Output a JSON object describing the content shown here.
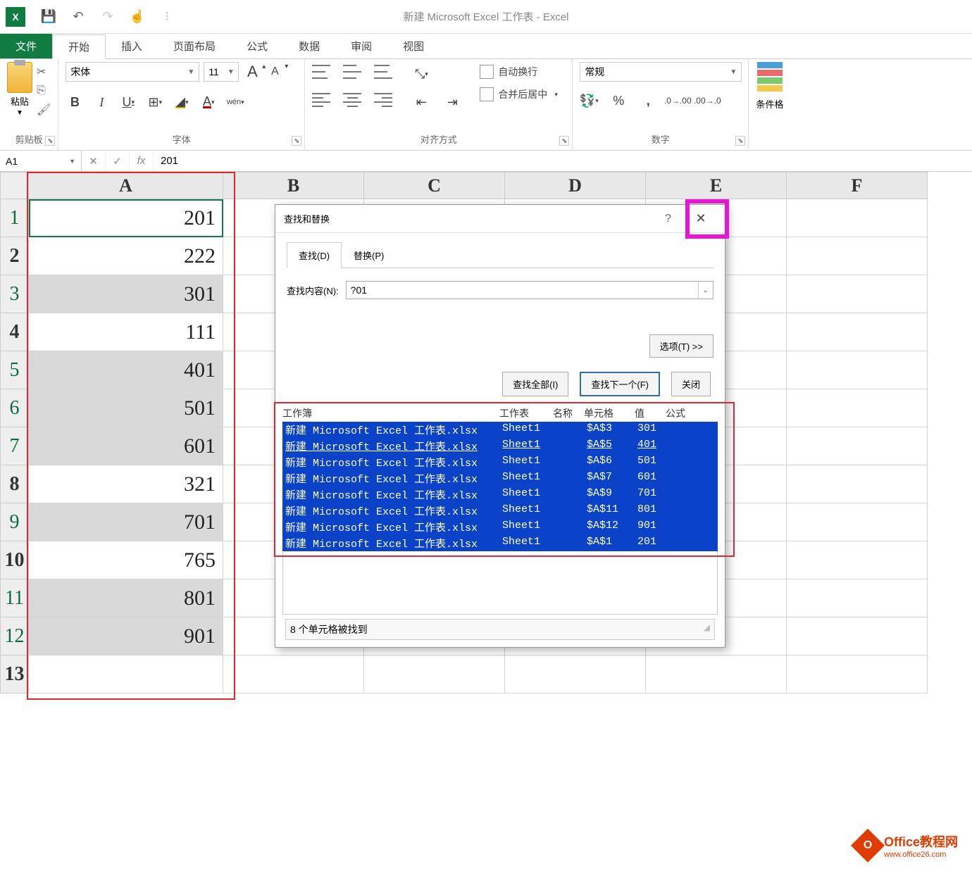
{
  "app": {
    "doc_title": "新建 Microsoft Excel 工作表 - Excel"
  },
  "qat": {
    "save": "save",
    "undo": "undo",
    "redo": "redo",
    "touch": "touch"
  },
  "tabs": {
    "file": "文件",
    "home": "开始",
    "insert": "插入",
    "page_layout": "页面布局",
    "formulas": "公式",
    "data": "数据",
    "review": "审阅",
    "view": "视图"
  },
  "ribbon": {
    "clipboard": {
      "paste": "粘贴",
      "label": "剪贴板"
    },
    "font": {
      "name": "宋体",
      "size": "11",
      "bold": "B",
      "italic": "I",
      "underline": "U",
      "label": "字体",
      "phonetic": "wén"
    },
    "alignment": {
      "wrap": "自动换行",
      "merge": "合并后居中",
      "label": "对齐方式"
    },
    "number": {
      "format": "常规",
      "label": "数字"
    },
    "styles": {
      "cf": "条件格"
    }
  },
  "formula_bar": {
    "name_box": "A1",
    "fx": "fx",
    "value": "201",
    "cancel": "✕",
    "enter": "✓"
  },
  "sheet": {
    "cols": [
      "A",
      "B",
      "C",
      "D",
      "E",
      "F"
    ],
    "rows": [
      {
        "n": "1",
        "v": "201",
        "sel": true,
        "active": true
      },
      {
        "n": "2",
        "v": "222",
        "sel": false
      },
      {
        "n": "3",
        "v": "301",
        "sel": true
      },
      {
        "n": "4",
        "v": "111",
        "sel": false
      },
      {
        "n": "5",
        "v": "401",
        "sel": true
      },
      {
        "n": "6",
        "v": "501",
        "sel": true
      },
      {
        "n": "7",
        "v": "601",
        "sel": true
      },
      {
        "n": "8",
        "v": "321",
        "sel": false
      },
      {
        "n": "9",
        "v": "701",
        "sel": true
      },
      {
        "n": "10",
        "v": "765",
        "sel": false
      },
      {
        "n": "11",
        "v": "801",
        "sel": true
      },
      {
        "n": "12",
        "v": "901",
        "sel": true
      },
      {
        "n": "13",
        "v": "",
        "sel": false
      }
    ]
  },
  "dialog": {
    "title": "查找和替换",
    "tab_find": "查找(D)",
    "tab_replace": "替换(P)",
    "find_label": "查找内容(N):",
    "find_value": "?01",
    "options_btn": "选项(T) >>",
    "find_all": "查找全部(I)",
    "find_next": "查找下一个(F)",
    "close": "关闭",
    "headers": {
      "workbook": "工作簿",
      "worksheet": "工作表",
      "name": "名称",
      "cell": "单元格",
      "value": "值",
      "formula": "公式"
    },
    "results": [
      {
        "wb": "新建 Microsoft Excel 工作表.xlsx",
        "ws": "Sheet1",
        "cell": "$A$3",
        "val": "301"
      },
      {
        "wb": "新建 Microsoft Excel 工作表.xlsx",
        "ws": "Sheet1",
        "cell": "$A$5",
        "val": "401",
        "active": true
      },
      {
        "wb": "新建 Microsoft Excel 工作表.xlsx",
        "ws": "Sheet1",
        "cell": "$A$6",
        "val": "501"
      },
      {
        "wb": "新建 Microsoft Excel 工作表.xlsx",
        "ws": "Sheet1",
        "cell": "$A$7",
        "val": "601"
      },
      {
        "wb": "新建 Microsoft Excel 工作表.xlsx",
        "ws": "Sheet1",
        "cell": "$A$9",
        "val": "701"
      },
      {
        "wb": "新建 Microsoft Excel 工作表.xlsx",
        "ws": "Sheet1",
        "cell": "$A$11",
        "val": "801"
      },
      {
        "wb": "新建 Microsoft Excel 工作表.xlsx",
        "ws": "Sheet1",
        "cell": "$A$12",
        "val": "901"
      },
      {
        "wb": "新建 Microsoft Excel 工作表.xlsx",
        "ws": "Sheet1",
        "cell": "$A$1",
        "val": "201"
      }
    ],
    "status": "8 个单元格被找到"
  },
  "watermark": {
    "brand": "Office教程网",
    "url": "www.office26.com"
  }
}
